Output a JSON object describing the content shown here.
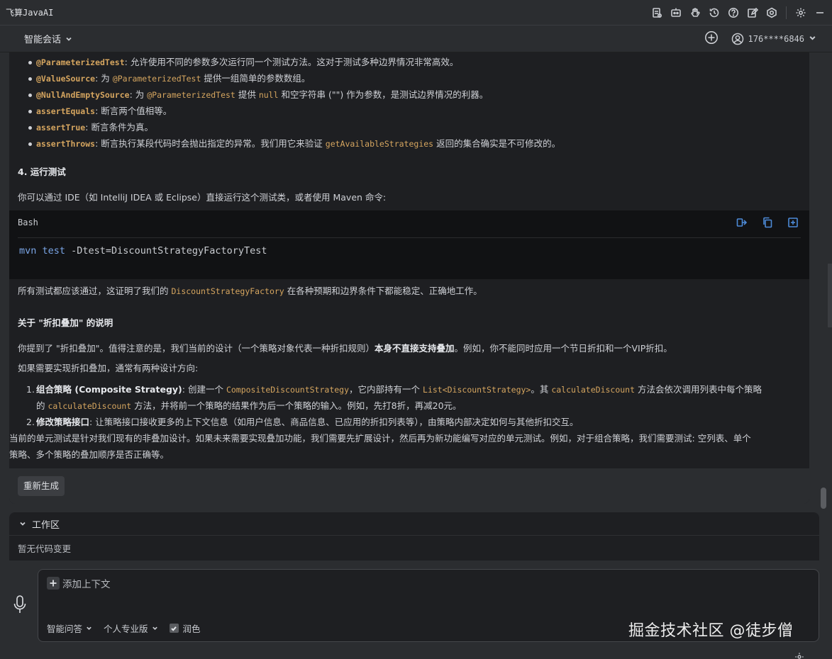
{
  "window": {
    "title": "飞算JavaAI"
  },
  "header": {
    "mode_label": "智能会话",
    "user_label": "176****6846"
  },
  "chat": {
    "bullets": [
      {
        "kw": "@ParameterizedTest",
        "sep": ": ",
        "rest": "允许使用不同的参数多次运行同一个测试方法。这对于测试多种边界情况非常高效。"
      },
      {
        "kw": "@ValueSource",
        "sep": ": 为 ",
        "code": "@ParameterizedTest",
        "rest": " 提供一组简单的参数数组。"
      },
      {
        "kw": "@NullAndEmptySource",
        "sep": ": 为 ",
        "code": "@ParameterizedTest",
        "mid": " 提供 ",
        "code2": "null",
        "rest": " 和空字符串 (\"\") 作为参数，是测试边界情况的利器。"
      },
      {
        "kw": "assertEquals",
        "sep": ": ",
        "rest": "断言两个值相等。"
      },
      {
        "kw": "assertTrue",
        "sep": ": ",
        "rest": "断言条件为真。"
      },
      {
        "kw": "assertThrows",
        "sep": ": ",
        "rest": "断言执行某段代码时会抛出指定的异常。我们用它来验证 ",
        "code": "getAvailableStrategies",
        "rest2": " 返回的集合确实是不可修改的。"
      }
    ],
    "section4_title": "4. 运行测试",
    "section4_text": "你可以通过 IDE（如 IntelliJ IDEA 或 Eclipse）直接运行这个测试类，或者使用 Maven 命令:",
    "code_lang": "Bash",
    "code_cmd": "mvn test",
    "code_args": " -Dtest=DiscountStrategyFactoryTest",
    "result_pre": "所有测试都应该通过，这证明了我们的 ",
    "result_code": "DiscountStrategyFactory",
    "result_post": " 在各种预期和边界条件下都能稳定、正确地工作。",
    "about_title": "关于 \"折扣叠加\" 的说明",
    "about_p1_pre": "你提到了 \"折扣叠加\"。值得注意的是，我们当前的设计（一个策略对象代表一种折扣规则）",
    "about_p1_bold": "本身不直接支持叠加",
    "about_p1_post": "。例如，你不能同时应用一个节日折扣和一个VIP折扣。",
    "about_p2": "如果需要实现折扣叠加，通常有两种设计方向:",
    "ol": [
      {
        "num": "1.",
        "title": "组合策略 (Composite Strategy)",
        "sep": ": 创建一个 ",
        "code1": "CompositeDiscountStrategy",
        "t1": "，它内部持有一个 ",
        "code2": "List<DiscountStrategy>",
        "t2": "。其 ",
        "code3": "calculateDiscount",
        "t3": " 方法会依次调用列表中每个策略",
        "line2_pre": "的 ",
        "line2_code": "calculateDiscount",
        "line2_post": " 方法，并将前一个策略的结果作为后一个策略的输入。例如，先打8折，再减20元。"
      },
      {
        "num": "2.",
        "title": "修改策略接口",
        "sep": ": ",
        "rest": "让策略接口接收更多的上下文信息（如用户信息、商品信息、已应用的折扣列表等），由策略内部决定如何与其他折扣交互。"
      }
    ],
    "final_line1": "当前的单元测试是针对我们现有的非叠加设计。如果未来需要实现叠加功能，我们需要先扩展设计，然后再为新功能编写对应的单元测试。例如，对于组合策略，我们需要测试: 空列表、单个",
    "final_line2": "策略、多个策略的叠加顺序是否正确等。",
    "regenerate_label": "重新生成"
  },
  "workspace": {
    "title": "工作区",
    "empty_text": "暂无代码变更"
  },
  "input": {
    "add_context_label": "添加上下文",
    "placeholder": "",
    "mode_label": "智能问答",
    "plan_label": "个人专业版",
    "polish_label": "润色",
    "polish_checked": true
  },
  "watermark": "掘金技术社区 @徒步僧"
}
